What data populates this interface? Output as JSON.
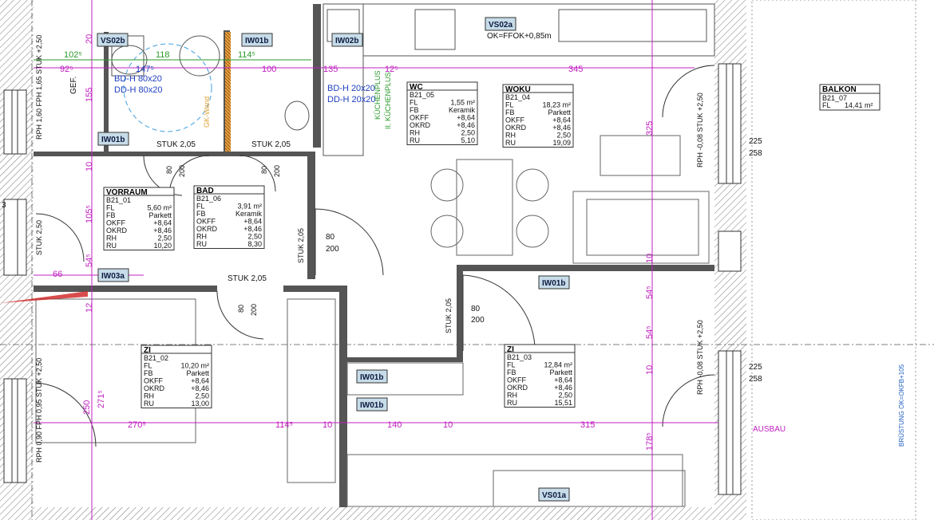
{
  "rooms": [
    {
      "id": "vorraum",
      "name": "VORRAUM",
      "code": "B21_01",
      "rows": [
        [
          "FL",
          "5,60 m²"
        ],
        [
          "FB",
          "Parkett"
        ],
        [
          "OKFF",
          "+8,64"
        ],
        [
          "OKRD",
          "+8,46"
        ],
        [
          "RH",
          "2,50"
        ],
        [
          "RU",
          "10,20"
        ]
      ]
    },
    {
      "id": "bad",
      "name": "BAD",
      "code": "B21_06",
      "rows": [
        [
          "FL",
          "3,91 m²"
        ],
        [
          "FB",
          "Keramik"
        ],
        [
          "OKFF",
          "+8,64"
        ],
        [
          "OKRD",
          "+8,46"
        ],
        [
          "RH",
          "2,50"
        ],
        [
          "RU",
          "8,30"
        ]
      ]
    },
    {
      "id": "wc",
      "name": "WC",
      "code": "B21_05",
      "rows": [
        [
          "FL",
          "1,55 m²"
        ],
        [
          "FB",
          "Keramik"
        ],
        [
          "OKFF",
          "+8,64"
        ],
        [
          "OKRD",
          "+8,46"
        ],
        [
          "RH",
          "2,50"
        ],
        [
          "RU",
          "5,10"
        ]
      ]
    },
    {
      "id": "woku",
      "name": "WOKU",
      "code": "B21_04",
      "rows": [
        [
          "FL",
          "18,23 m²"
        ],
        [
          "FB",
          "Parkett"
        ],
        [
          "OKFF",
          "+8,64"
        ],
        [
          "OKRD",
          "+8,46"
        ],
        [
          "RH",
          "2,50"
        ],
        [
          "RU",
          "19,09"
        ]
      ]
    },
    {
      "id": "zi1",
      "name": "ZI",
      "code": "B21_02",
      "rows": [
        [
          "FL",
          "10,20 m²"
        ],
        [
          "FB",
          "Parkett"
        ],
        [
          "OKFF",
          "+8,64"
        ],
        [
          "OKRD",
          "+8,46"
        ],
        [
          "RH",
          "2,50"
        ],
        [
          "RU",
          "13,00"
        ]
      ]
    },
    {
      "id": "zi2",
      "name": "ZI",
      "code": "B21_03",
      "rows": [
        [
          "FL",
          "12,84 m²"
        ],
        [
          "FB",
          "Parkett"
        ],
        [
          "OKFF",
          "+8,64"
        ],
        [
          "OKRD",
          "+8,46"
        ],
        [
          "RH",
          "2,50"
        ],
        [
          "RU",
          "15,51"
        ]
      ]
    }
  ],
  "balkon": {
    "name": "BALKON",
    "code": "B21_07",
    "fl_label": "FL",
    "fl_value": "14,41 m²"
  },
  "tags": {
    "vs02b_a": "VS02b",
    "iw01b_a": "IW01b",
    "iw02b": "IW02b",
    "vs02a": "VS02a",
    "iw01b_b": "IW01b",
    "iw03a": "IW03a",
    "iw01b_c": "IW01b",
    "iw01b_d": "IW01b",
    "iw01b_e": "IW01b",
    "vs01a": "VS01a"
  },
  "notes": {
    "vs02a_note": "OK=FFOK+0,85m",
    "ausbau": "AUSBAU",
    "gef": "GEF.",
    "bd_h_1": "BD-H 80x20",
    "dd_h_1": "DD-H 80x20",
    "bd_h_2": "BD-H 20x20",
    "dd_h_2": "DD-H 20x20",
    "gk_wand": "GK-Wand",
    "kuchenplus_1": "KÜCHENPLUS",
    "kuchenplus_2": "II. KÜCHENPLUS",
    "brustung": "BRÜSTUNG OK=OKFB+105",
    "stuk_1": "STUK 2,05",
    "stuk_2": "STUK 2,05",
    "stuk_3": "STUK 2,05",
    "stuk_v1": "STUK 2,50",
    "stuk_v2": "STUK 2,05",
    "stuk_v3": "STUK 2,05",
    "win_left_top": "RPH 1,60 FPH 1,65 STUK +2,50",
    "win_left_bot": "RPH 0,90 FPH 0,95 STUK +2,50",
    "win_right_top": "RPH -0,08 STUK +2,50",
    "win_right_bot": "RPH -0,08 STUK +2,50"
  },
  "doors": [
    {
      "w": "80",
      "h": "200"
    },
    {
      "w": "80",
      "h": "200"
    },
    {
      "w": "80",
      "h": "200"
    },
    {
      "w": "80",
      "h": "200"
    },
    {
      "w": "80",
      "h": "200"
    }
  ],
  "dims": {
    "d102": "102⁵",
    "d147": "147⁵",
    "d118": "118",
    "d114a": "114⁵",
    "d100": "100",
    "d92": "92⁵",
    "d135": "135",
    "d12": "12⁵",
    "d345": "345",
    "d155": "155",
    "d20": "20",
    "d10a": "10",
    "d105": "105⁵",
    "d54a": "54⁵",
    "d12b": "12",
    "d66": "66",
    "d271": "271⁵",
    "d250": "250",
    "d270": "270⁵",
    "d114b": "114⁵",
    "d10b": "10",
    "d140": "140",
    "d10c": "10",
    "d315": "315",
    "d325": "325",
    "d10d": "10",
    "d54b": "54⁵",
    "d54c": "54⁵",
    "d10e": "10",
    "d178": "178⁵",
    "d225a": "225",
    "d258a": "258",
    "d225b": "225",
    "d258b": "258",
    "d3": "3"
  },
  "colors": {
    "wall": "#555555",
    "dim": "#c020c0",
    "green": "#2a9a2a",
    "blue": "#2040c0",
    "tagfill": "#c7dce8",
    "orange": "#e0a030",
    "red": "#d02020"
  }
}
